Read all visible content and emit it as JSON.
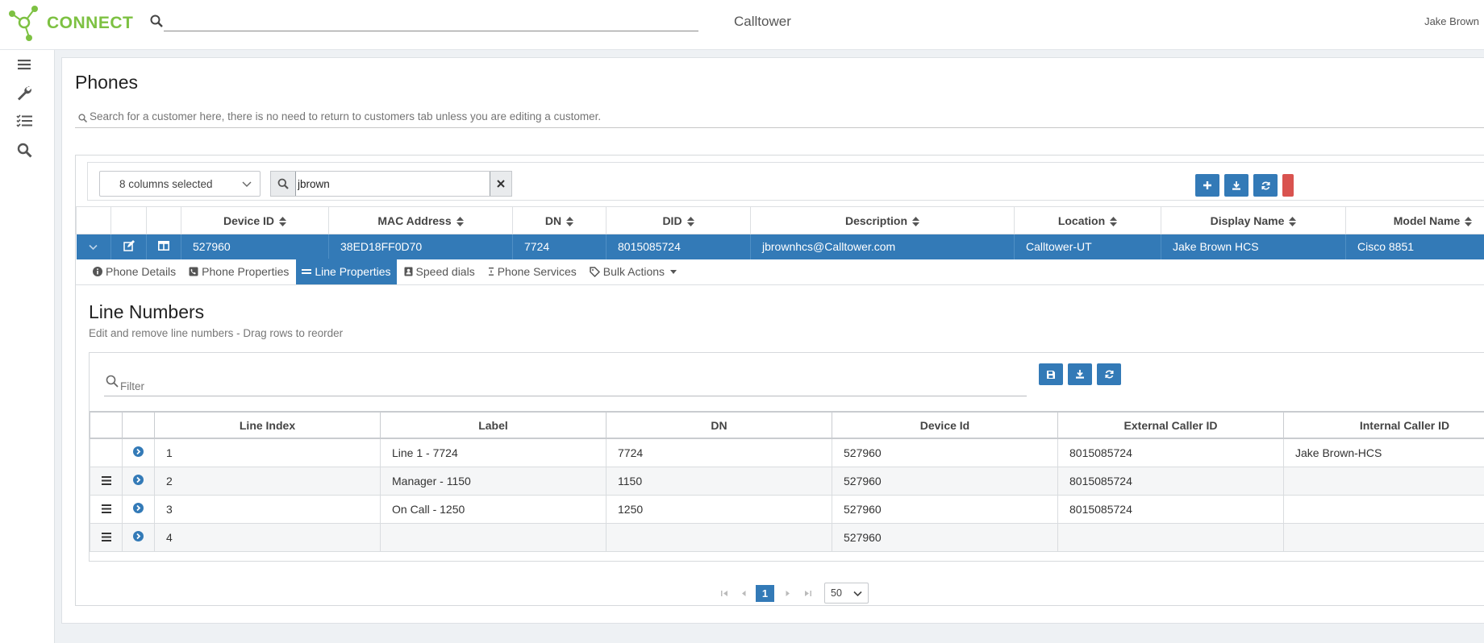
{
  "brand": {
    "name": "CONNECT",
    "accent": "#7dc142",
    "primary": "#337ab7"
  },
  "header": {
    "search_value": "",
    "tenant": "Calltower",
    "user": "Jake Brown"
  },
  "sidebar": {
    "icons": [
      "menu-icon",
      "wrench-icon",
      "checklist-icon",
      "search-icon"
    ]
  },
  "page": {
    "title": "Phones",
    "customer_search_placeholder": "Search for a customer here, there is no need to return to customers tab unless you are editing a customer."
  },
  "toolbar": {
    "columns_selected": "8 columns selected",
    "search_value": "jbrown"
  },
  "phones_table": {
    "headers": [
      "Device ID",
      "MAC Address",
      "DN",
      "DID",
      "Description",
      "Location",
      "Display Name",
      "Model Name"
    ],
    "row": {
      "device_id": "527960",
      "mac": "38ED18FF0D70",
      "dn": "7724",
      "did": "8015085724",
      "description": "jbrownhcs@Calltower.com",
      "location": "Calltower-UT",
      "display_name": "Jake Brown HCS",
      "model": "Cisco 8851"
    }
  },
  "tabs": [
    {
      "label": "Phone Details",
      "icon": "info-icon"
    },
    {
      "label": "Phone Properties",
      "icon": "phone-icon"
    },
    {
      "label": "Line Properties",
      "icon": "lines-icon",
      "active": true
    },
    {
      "label": "Speed dials",
      "icon": "contact-card-icon"
    },
    {
      "label": "Phone Services",
      "icon": "service-icon"
    },
    {
      "label": "Bulk Actions",
      "icon": "tag-icon"
    }
  ],
  "line_numbers": {
    "title": "Line Numbers",
    "subtitle": "Edit and remove line numbers - Drag rows to reorder",
    "filter_placeholder": "Filter",
    "headers": [
      "Line Index",
      "Label",
      "DN",
      "Device Id",
      "External Caller ID",
      "Internal Caller ID"
    ],
    "rows": [
      {
        "index": "1",
        "label": "Line 1 - 7724",
        "dn": "7724",
        "device_id": "527960",
        "ext_cid": "8015085724",
        "int_cid": "Jake Brown-HCS"
      },
      {
        "index": "2",
        "label": "Manager - 1150",
        "dn": "1150",
        "device_id": "527960",
        "ext_cid": "8015085724",
        "int_cid": ""
      },
      {
        "index": "3",
        "label": "On Call - 1250",
        "dn": "1250",
        "device_id": "527960",
        "ext_cid": "8015085724",
        "int_cid": ""
      },
      {
        "index": "4",
        "label": "",
        "dn": "",
        "device_id": "527960",
        "ext_cid": "",
        "int_cid": ""
      }
    ]
  },
  "pagination": {
    "current_page": "1",
    "page_size": "50"
  }
}
